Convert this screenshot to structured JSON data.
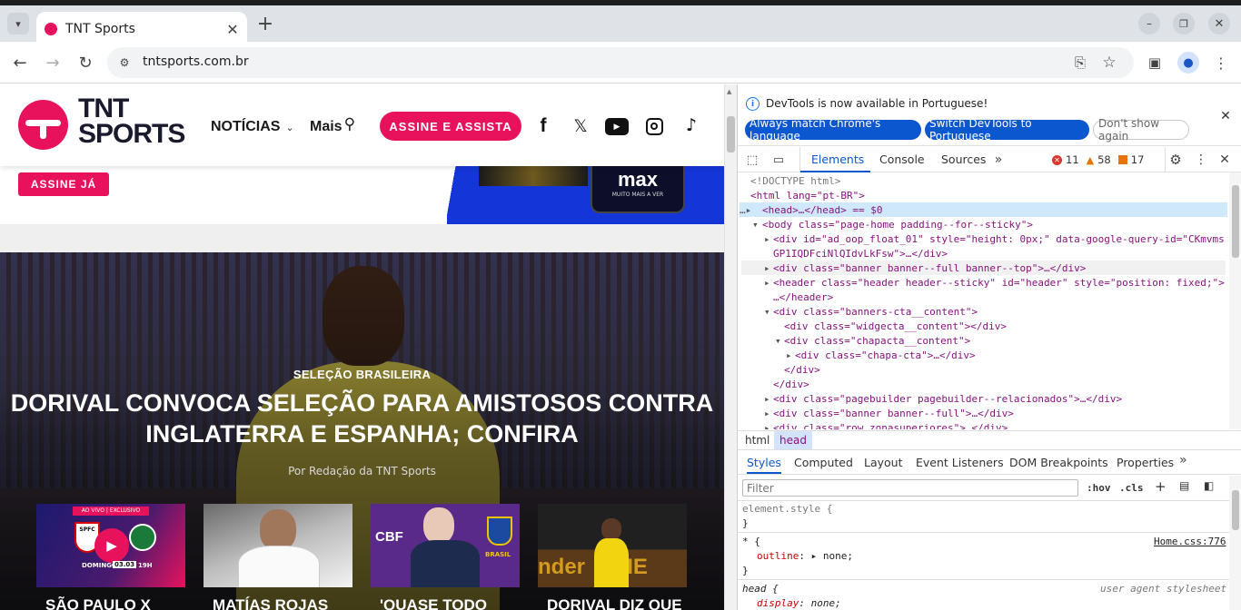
{
  "browser": {
    "tab_title": "TNT Sports",
    "url": "tntsports.com.br"
  },
  "site": {
    "logo_line1": "TNT",
    "logo_line2": "SPORTS",
    "nav_news": "NOTÍCIAS",
    "nav_more": "Mais",
    "cta_subscribe_watch": "ASSINE E ASSISTA",
    "cta_subscribe_now": "ASSINE JÁ",
    "banner_brand": "max",
    "banner_tagline": "MUITO MAIS A VER",
    "hero": {
      "category": "SELEÇÃO BRASILEIRA",
      "headline_1": "DORIVAL CONVOCA SELEÇÃO PARA AMISTOSOS CONTRA",
      "headline_2": "INGLATERRA E ESPANHA; CONFIRA",
      "byline": "Por Redação da TNT Sports"
    },
    "cards": [
      {
        "title": "SÃO PAULO X",
        "tag": "AO VIVO | EXCLUSIVO",
        "team_a": "SPFC",
        "date_label": "DOMINGO",
        "date": "03.03",
        "time": "19H"
      },
      {
        "title": "MATÍAS ROJAS"
      },
      {
        "title": "'QUASE TODO",
        "logo": "CBF",
        "badge": "BRASIL"
      },
      {
        "title": "DORIVAL DIZ QUE",
        "ad": "nder  A HE"
      }
    ]
  },
  "devtools": {
    "info_message": "DevTools is now available in Portuguese!",
    "btn_match_language": "Always match Chrome's language",
    "btn_switch": "Switch DevTools to Portuguese",
    "btn_dont_show": "Don't show again",
    "tabs": [
      "Elements",
      "Console",
      "Sources"
    ],
    "errors": "11",
    "warnings": "58",
    "issues": "17",
    "dom_lines": [
      "<!DOCTYPE html>",
      "<html lang=\"pt-BR\">",
      "<head>…</head> == $0",
      "<body class=\"page-home padding--for--sticky\">",
      "<div id=\"ad_oop_float_01\" style=\"height: 0px;\" data-google-query-id=\"CKmvms",
      "GP1IQDFciNlQIdvLkFsw\">…</div>",
      "<div class=\"banner banner--full banner--top\">…</div>",
      "<header class=\"header header--sticky\" id=\"header\" style=\"position: fixed;\">",
      "…</header>",
      "<div class=\"banners-cta__content\">",
      "<div class=\"widgecta__content\"></div>",
      "<div class=\"chapacta__content\">",
      "<div class=\"chapa-cta\">…</div>",
      "</div>",
      "</div>",
      "<div class=\"pagebuilder pagebuilder--relacionados\">…</div>",
      "<div class=\"banner banner--full\">…</div>",
      "<div class=\"row zonasuperiores\">…</div>"
    ],
    "breadcrumb": [
      "html",
      "head"
    ],
    "style_tabs": [
      "Styles",
      "Computed",
      "Layout",
      "Event Listeners",
      "DOM Breakpoints",
      "Properties"
    ],
    "filter_placeholder": "Filter",
    "hov": ":hov",
    "cls": ".cls",
    "rule1_selector": "element.style {",
    "rule_close": "}",
    "rule2_selector": "* {",
    "rule2_source": "Home.css:776",
    "rule2_prop": "outline",
    "rule2_val": "none;",
    "rule3_selector": "head {",
    "rule3_source": "user agent stylesheet",
    "rule3_prop": "display",
    "rule3_val": "none;"
  }
}
